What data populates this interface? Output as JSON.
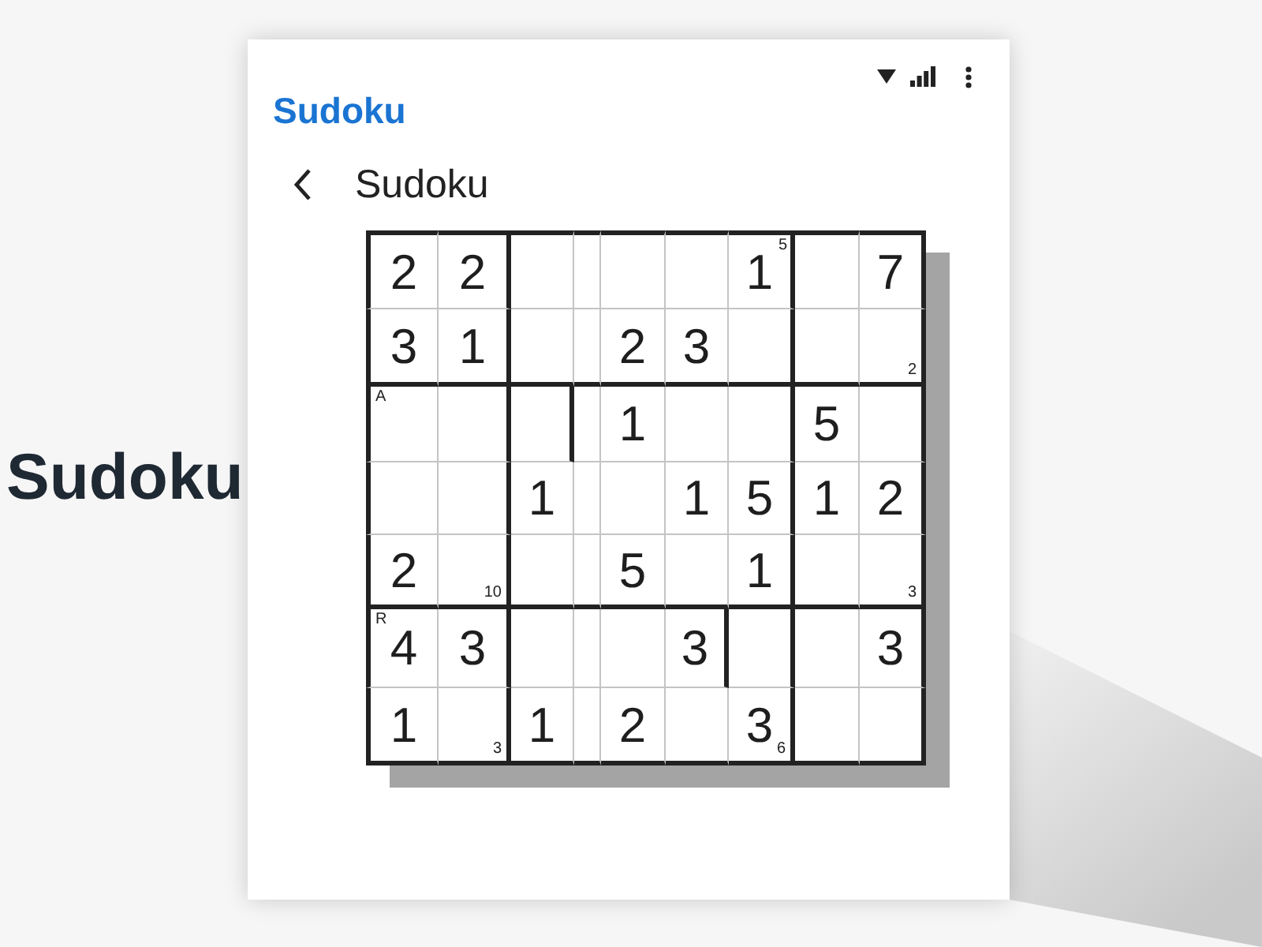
{
  "backdrop": {
    "title": "Sudoku"
  },
  "app_bar": {
    "app_name": "Sudoku"
  },
  "toolbar": {
    "title": "Sudoku"
  },
  "grid": {
    "rows": [
      [
        {
          "value": "2"
        },
        {
          "value": "2"
        },
        {},
        {},
        {},
        {},
        {
          "value": "1",
          "top_right_note": "5"
        },
        {},
        {
          "value": "7"
        }
      ],
      [
        {
          "value": "3"
        },
        {
          "value": "1"
        },
        {},
        {},
        {
          "value": "2"
        },
        {
          "value": "3"
        },
        {},
        {},
        {
          "bottom_right_note": "2"
        }
      ],
      [
        {
          "top_left_note": "A"
        },
        {},
        {},
        {},
        {
          "value": "1"
        },
        {},
        {},
        {
          "value": "5"
        },
        {}
      ],
      [
        {},
        {},
        {
          "value": "1"
        },
        {},
        {},
        {
          "value": "1"
        },
        {
          "value": "5"
        },
        {
          "value": "1"
        },
        {
          "value": "2"
        }
      ],
      [
        {
          "value": "2"
        },
        {
          "bottom_right_note": "10"
        },
        {},
        {},
        {
          "value": "5"
        },
        {},
        {
          "value": "1"
        },
        {},
        {
          "bottom_right_note": "3"
        }
      ],
      [
        {
          "value": "4",
          "top_left_note": "R"
        },
        {
          "value": "3"
        },
        {},
        {},
        {},
        {
          "value": "3"
        },
        {},
        {},
        {
          "value": "3"
        }
      ],
      [
        {
          "value": "1"
        },
        {
          "bottom_right_note": "3"
        },
        {
          "value": "1"
        },
        {},
        {
          "value": "2"
        },
        {},
        {
          "value": "3",
          "bottom_right_note": "6"
        },
        {},
        {}
      ]
    ]
  }
}
